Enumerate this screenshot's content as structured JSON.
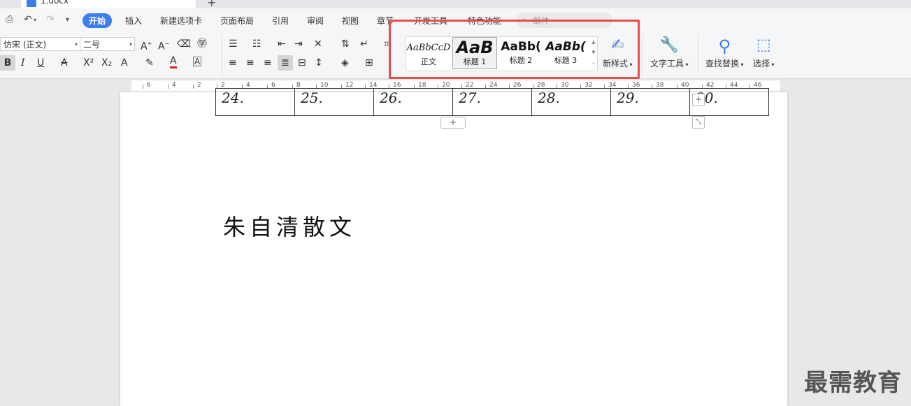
{
  "window": {
    "doc_tab": "1.docx",
    "new_tab": "+"
  },
  "menu": {
    "tabs": [
      "开始",
      "插入",
      "新建选项卡",
      "页面布局",
      "引用",
      "审阅",
      "视图",
      "章节",
      "开发工具",
      "特色功能"
    ],
    "search_placeholder": "邮件"
  },
  "font": {
    "name": "仿宋 (正文)",
    "size": "二号"
  },
  "styles": {
    "items": [
      {
        "sample": "AaBbCcD",
        "label": "正文"
      },
      {
        "sample": "AaB",
        "label": "标题 1"
      },
      {
        "sample": "AaBb(",
        "label": "标题 2"
      },
      {
        "sample": "AaBb(",
        "label": "标题 3"
      }
    ],
    "new_style": "新样式",
    "text_tool": "文字工具",
    "find_replace": "查找替换",
    "select": "选择"
  },
  "ruler": {
    "ticks": [
      "6",
      "4",
      "2",
      "2",
      "4",
      "6",
      "8",
      "10",
      "12",
      "14",
      "16",
      "18",
      "20",
      "22",
      "24",
      "26",
      "28",
      "30",
      "32",
      "34",
      "36",
      "38",
      "40",
      "42",
      "44",
      "46"
    ]
  },
  "table": {
    "cells": [
      "24.",
      "25.",
      "26.",
      "27.",
      "28.",
      "29.",
      "30."
    ]
  },
  "document": {
    "heading": "朱自清散文"
  },
  "watermark": "最需教育",
  "colors": {
    "accent": "#3c7ef2",
    "highlight_border": "#e84c4c"
  }
}
